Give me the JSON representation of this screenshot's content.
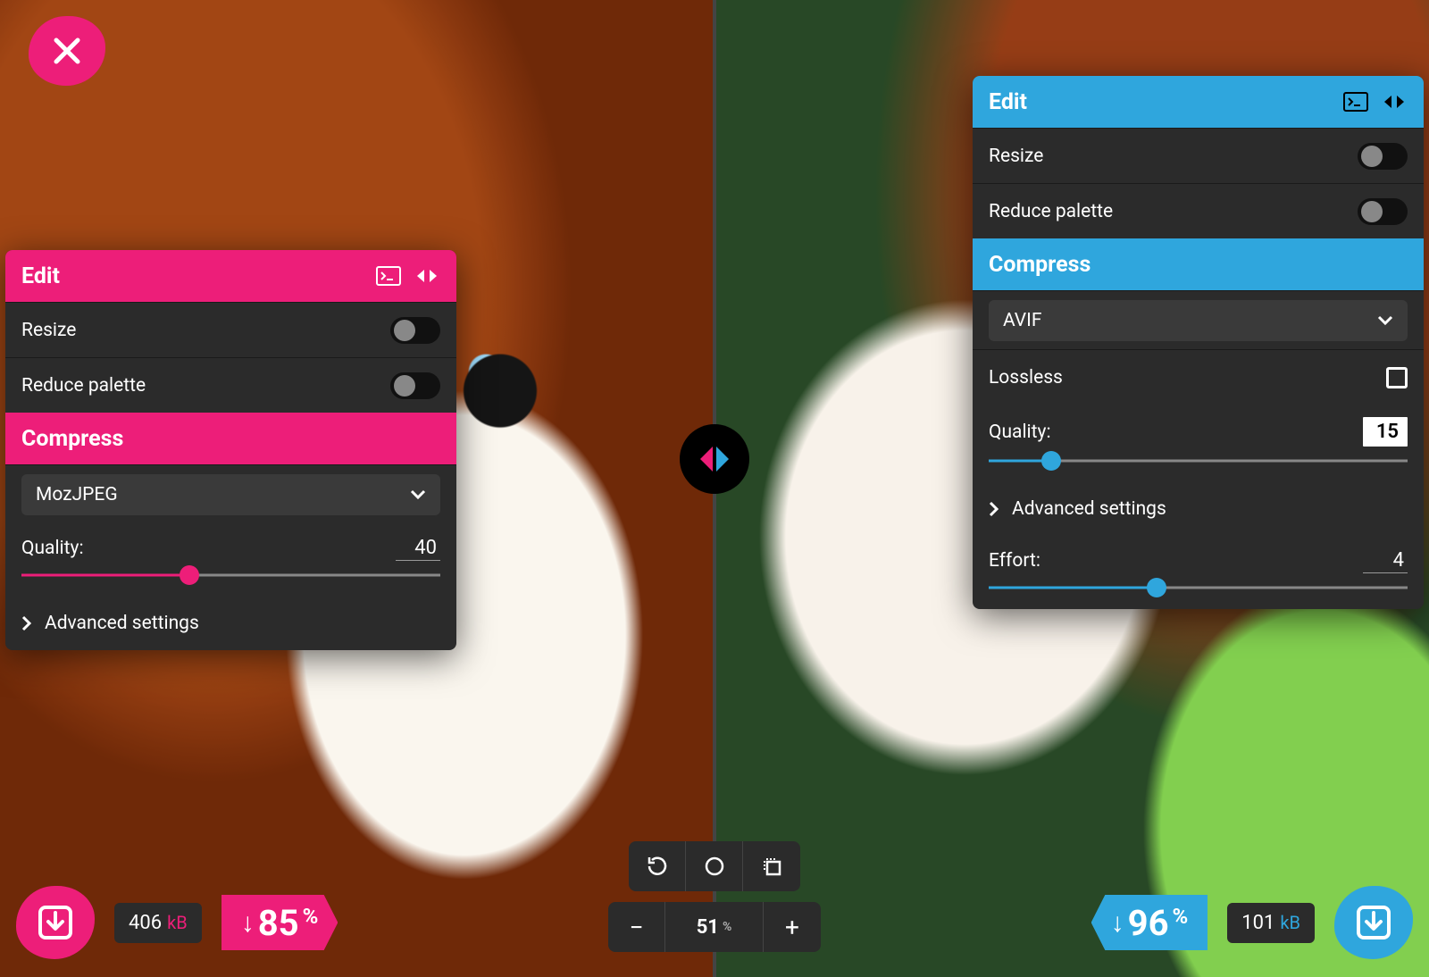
{
  "close_label": "Close",
  "left": {
    "edit_title": "Edit",
    "resize_label": "Resize",
    "reduce_palette_label": "Reduce palette",
    "compress_title": "Compress",
    "codec": "MozJPEG",
    "quality_label": "Quality:",
    "quality_value": "40",
    "quality_pct": 40,
    "advanced_label": "Advanced settings",
    "file_size_value": "406",
    "file_size_unit": "kB",
    "reduction_arrow": "↓",
    "reduction_value": "85",
    "reduction_pct": "%"
  },
  "right": {
    "edit_title": "Edit",
    "resize_label": "Resize",
    "reduce_palette_label": "Reduce palette",
    "compress_title": "Compress",
    "codec": "AVIF",
    "lossless_label": "Lossless",
    "quality_label": "Quality:",
    "quality_value": "15",
    "quality_pct": 15,
    "advanced_label": "Advanced settings",
    "effort_label": "Effort:",
    "effort_value": "4",
    "effort_pct": 40,
    "file_size_value": "101",
    "file_size_unit": "kB",
    "reduction_arrow": "↓",
    "reduction_value": "96",
    "reduction_pct": "%"
  },
  "center": {
    "zoom_value": "51",
    "zoom_pct": "%"
  },
  "colors": {
    "pink": "#ed1e79",
    "blue": "#2fa6dd"
  }
}
